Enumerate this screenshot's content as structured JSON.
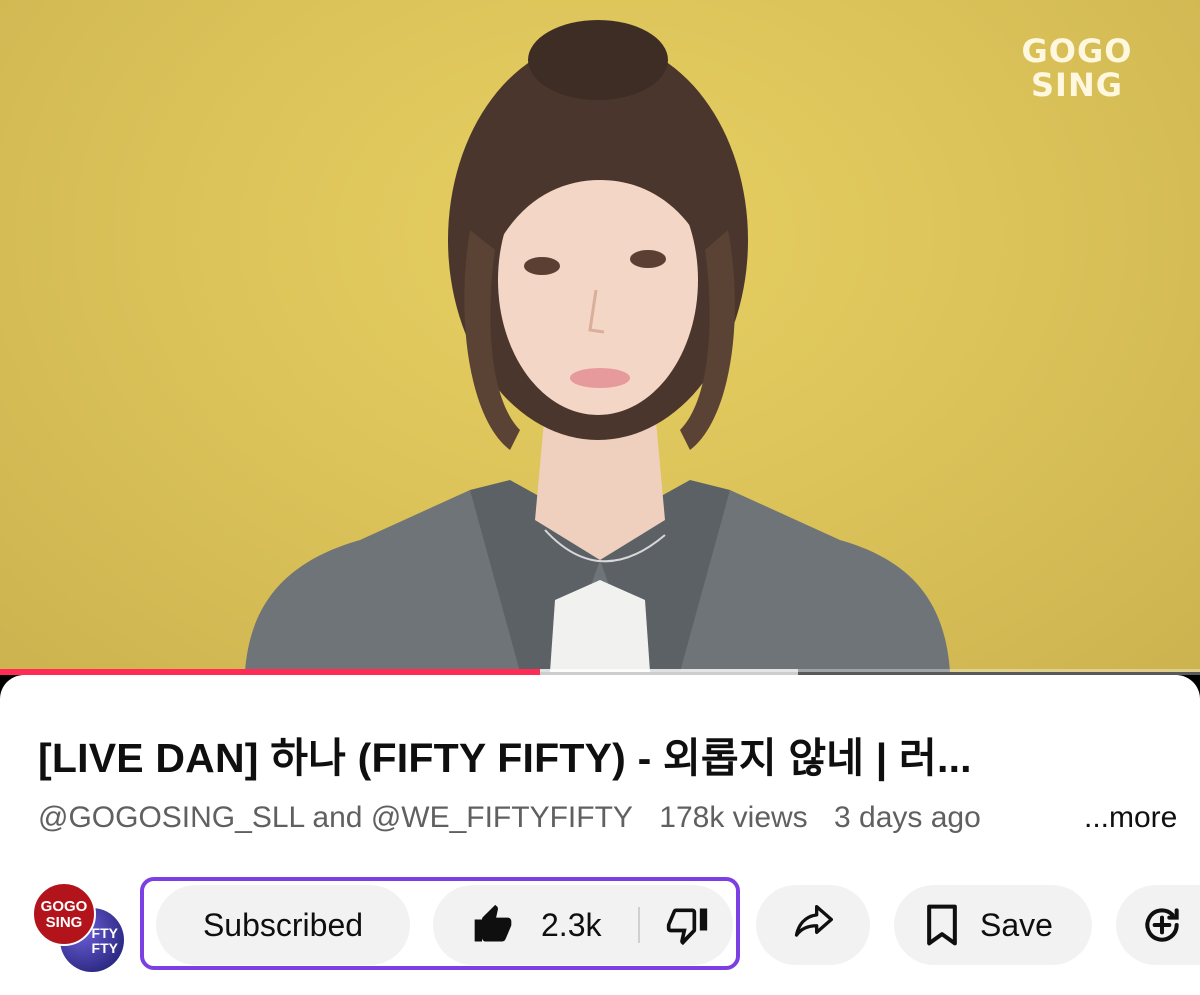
{
  "video": {
    "logo_line1": "GOGO",
    "logo_line2": "SING",
    "background_color": "#dcc45a",
    "progress_played": 0.45,
    "progress_buffered": 0.665,
    "progress_color": "#ff2d55"
  },
  "title": "[LIVE DAN] 하나 (FIFTY FIFTY) - 외롭지 않네 | 러...",
  "meta": {
    "channels": "@GOGOSING_SLL and @WE_FIFTYFIFTY",
    "views": "178k views",
    "age": "3 days ago",
    "more": "...more"
  },
  "avatars": {
    "gogosing_line1": "GOGO",
    "gogosing_line2": "SING",
    "fiftyfifty_line1": "FTY",
    "fiftyfifty_line2": "FTY"
  },
  "actions": {
    "subscribed": "Subscribed",
    "like_count": "2.3k",
    "save": "Save",
    "highlight_color": "#7b3fe4",
    "icons": [
      "thumbs-up-icon",
      "thumbs-down-icon",
      "share-icon",
      "bookmark-icon",
      "clip-icon"
    ]
  }
}
